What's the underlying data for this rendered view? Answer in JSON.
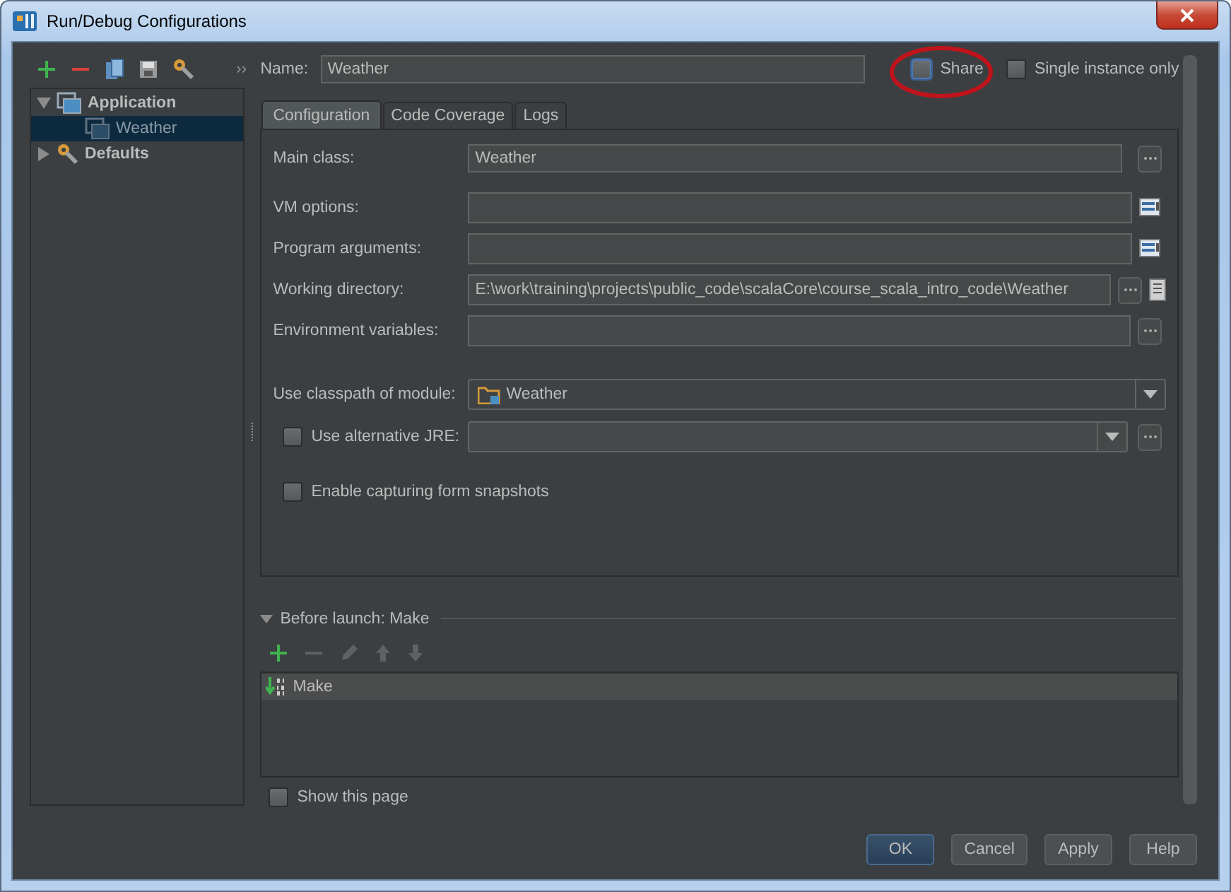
{
  "window": {
    "title": "Run/Debug Configurations"
  },
  "sidebar": {
    "overflow": "››",
    "tree": [
      {
        "label": "Application",
        "kind": "app",
        "expanded": true,
        "selected": false,
        "children": [
          {
            "label": "Weather",
            "kind": "config",
            "selected": true
          }
        ]
      },
      {
        "label": "Defaults",
        "kind": "defaults",
        "expanded": false,
        "selected": false
      }
    ]
  },
  "name_field": {
    "label": "Name:",
    "value": "Weather"
  },
  "options": [
    {
      "label": "Share",
      "checked": false,
      "highlighted": true
    },
    {
      "label": "Single instance only",
      "checked": false,
      "highlighted": false
    }
  ],
  "tabs": [
    {
      "label": "Configuration",
      "selected": true
    },
    {
      "label": "Code Coverage",
      "selected": false
    },
    {
      "label": "Logs",
      "selected": false
    }
  ],
  "form": {
    "fields": [
      {
        "label": "Main class:",
        "value": "Weather",
        "kind": "browse"
      },
      {
        "label": "VM options:",
        "kind": "expand"
      },
      {
        "label": "Program arguments:",
        "kind": "expand"
      },
      {
        "label": "Working directory:",
        "value": "E:\\work\\training\\projects\\public_code\\scalaCore\\course_scala_intro_code\\Weather",
        "kind": "browse-macro"
      },
      {
        "label": "Environment variables:",
        "kind": "browse"
      }
    ],
    "module": {
      "label": "Use classpath of module:",
      "value": "Weather"
    },
    "alt_jre": {
      "label": "Use alternative JRE:",
      "checked": false
    },
    "snapshots": {
      "label": "Enable capturing form snapshots",
      "checked": false
    }
  },
  "before_launch": {
    "title": "Before launch: Make",
    "expanded": true,
    "tasks": [
      {
        "label": "Make",
        "selected": true
      }
    ]
  },
  "show_page": {
    "label": "Show this page",
    "checked": false
  },
  "buttons": [
    {
      "label": "OK",
      "default": true
    },
    {
      "label": "Cancel",
      "default": false
    },
    {
      "label": "Apply",
      "default": false
    },
    {
      "label": "Help",
      "default": false
    }
  ]
}
